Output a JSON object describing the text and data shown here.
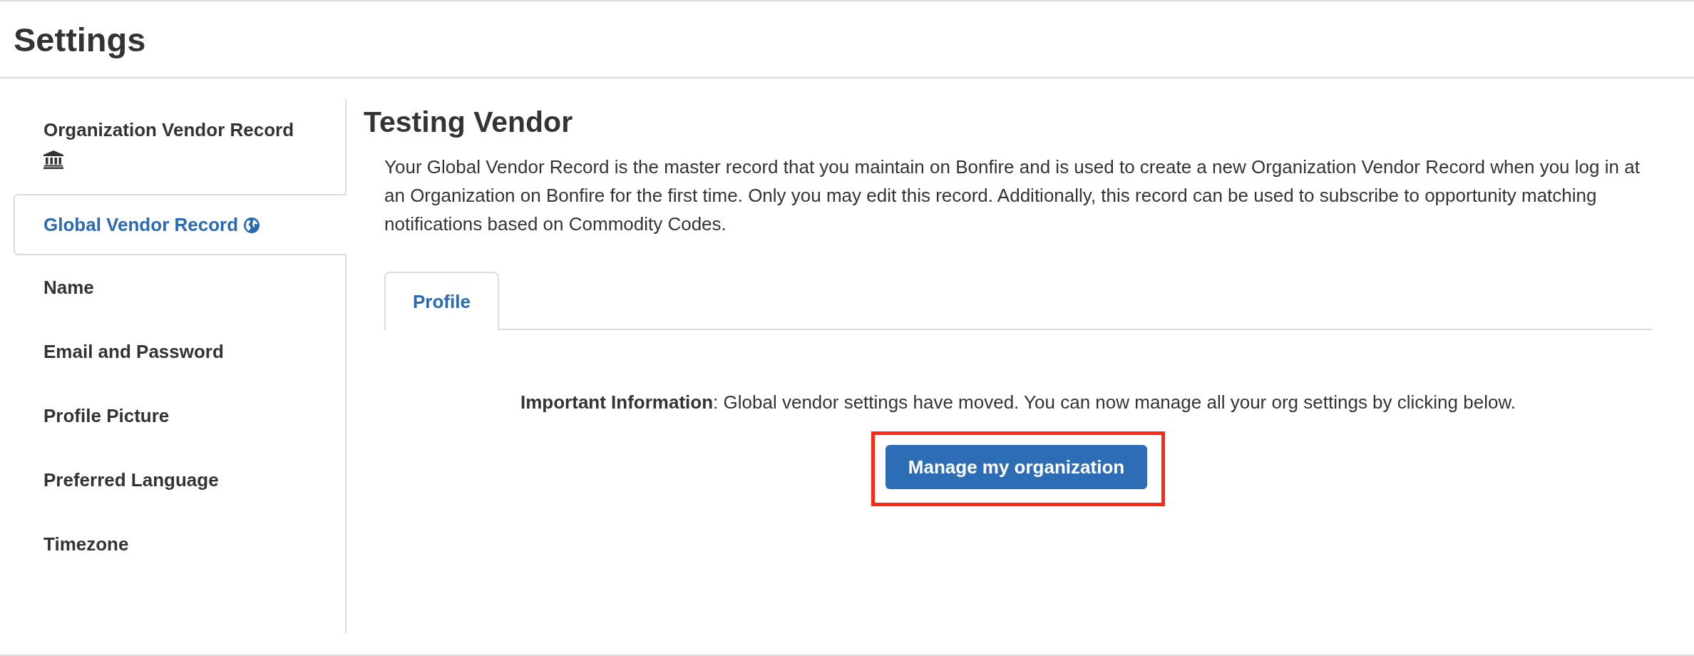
{
  "page": {
    "title": "Settings"
  },
  "sidebar": {
    "items": [
      {
        "label": "Organization Vendor Record",
        "kind": "organization",
        "selected": false
      },
      {
        "label": "Global Vendor Record",
        "kind": "global",
        "selected": true
      },
      {
        "label": "Name",
        "kind": "plain",
        "selected": false
      },
      {
        "label": "Email and Password",
        "kind": "plain",
        "selected": false
      },
      {
        "label": "Profile Picture",
        "kind": "plain",
        "selected": false
      },
      {
        "label": "Preferred Language",
        "kind": "plain",
        "selected": false
      },
      {
        "label": "Timezone",
        "kind": "plain",
        "selected": false
      }
    ]
  },
  "main": {
    "title": "Testing Vendor",
    "description": "Your Global Vendor Record is the master record that you maintain on Bonfire and is used to create a new Organization Vendor Record when you log in at an Organization on Bonfire for the first time. Only you may edit this record. Additionally, this record can be used to subscribe to opportunity matching notifications based on Commodity Codes.",
    "tabs": [
      {
        "label": "Profile",
        "selected": true
      }
    ],
    "notice": "**Important Information**: Global vendor settings have moved. You can now manage all your org settings by clicking below.",
    "button": {
      "label": "Manage my organization",
      "highlighted": true
    }
  }
}
